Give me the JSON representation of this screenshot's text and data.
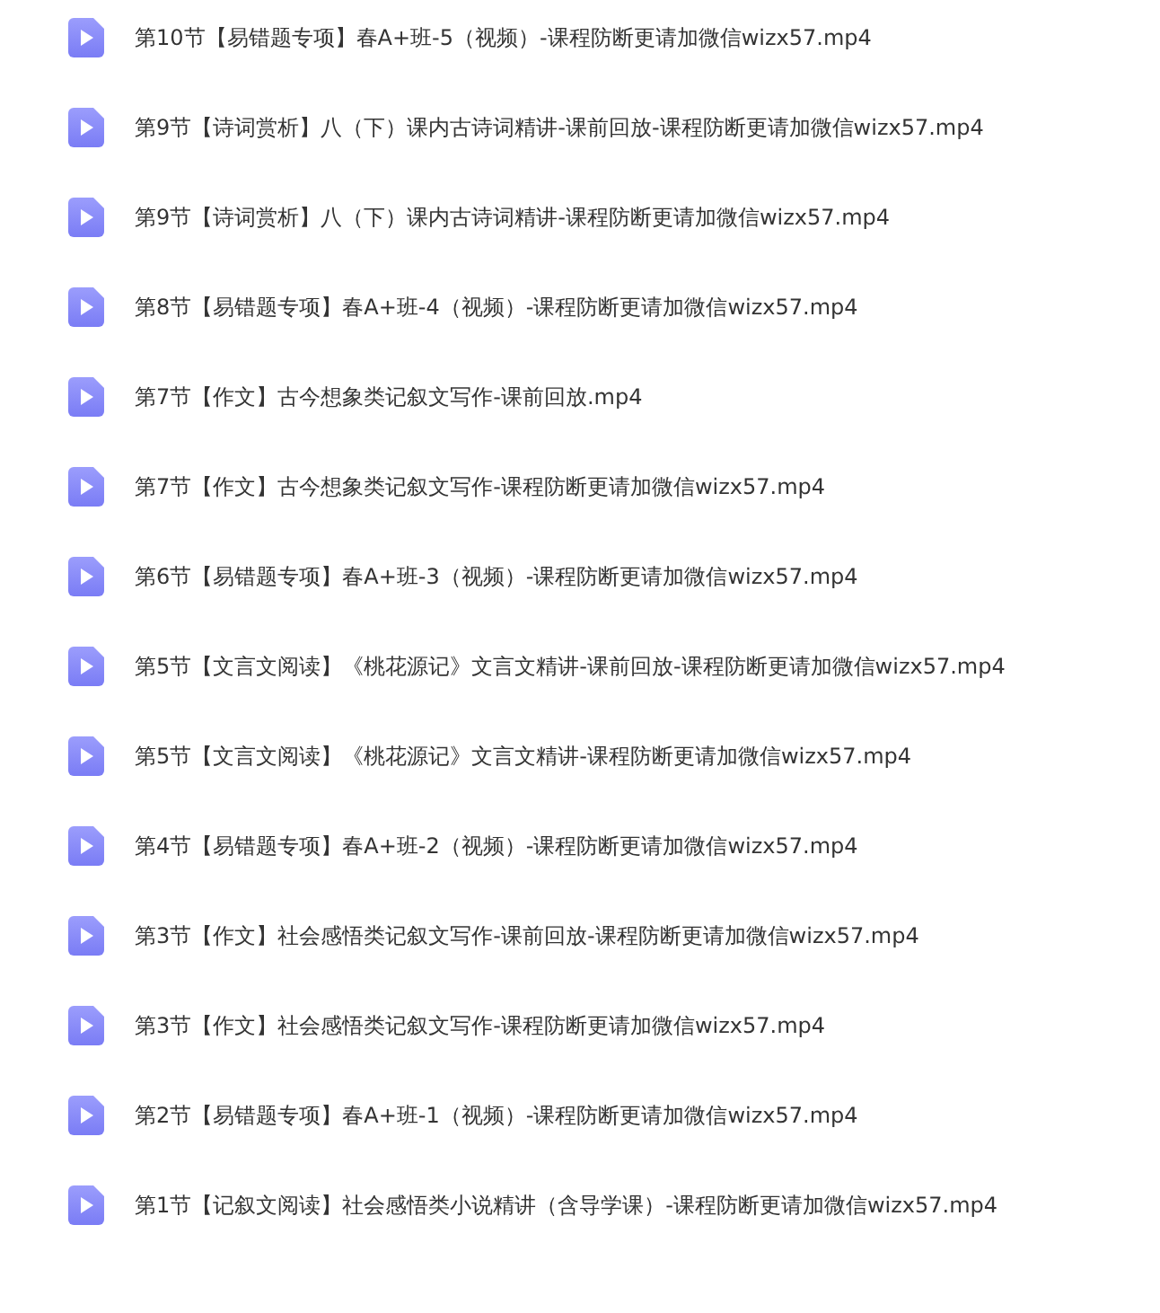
{
  "files": [
    {
      "name": "第10节【易错题专项】春A+班-5（视频）-课程防断更请加微信wizx57.mp4"
    },
    {
      "name": "第9节【诗词赏析】八（下）课内古诗词精讲-课前回放-课程防断更请加微信wizx57.mp4"
    },
    {
      "name": "第9节【诗词赏析】八（下）课内古诗词精讲-课程防断更请加微信wizx57.mp4"
    },
    {
      "name": "第8节【易错题专项】春A+班-4（视频）-课程防断更请加微信wizx57.mp4"
    },
    {
      "name": "第7节【作文】古今想象类记叙文写作-课前回放.mp4"
    },
    {
      "name": "第7节【作文】古今想象类记叙文写作-课程防断更请加微信wizx57.mp4"
    },
    {
      "name": "第6节【易错题专项】春A+班-3（视频）-课程防断更请加微信wizx57.mp4"
    },
    {
      "name": "第5节【文言文阅读】《桃花源记》文言文精讲-课前回放-课程防断更请加微信wizx57.mp4"
    },
    {
      "name": "第5节【文言文阅读】《桃花源记》文言文精讲-课程防断更请加微信wizx57.mp4"
    },
    {
      "name": "第4节【易错题专项】春A+班-2（视频）-课程防断更请加微信wizx57.mp4"
    },
    {
      "name": "第3节【作文】社会感悟类记叙文写作-课前回放-课程防断更请加微信wizx57.mp4"
    },
    {
      "name": "第3节【作文】社会感悟类记叙文写作-课程防断更请加微信wizx57.mp4"
    },
    {
      "name": "第2节【易错题专项】春A+班-1（视频）-课程防断更请加微信wizx57.mp4"
    },
    {
      "name": "第1节【记叙文阅读】社会感悟类小说精讲（含导学课）-课程防断更请加微信wizx57.mp4"
    }
  ]
}
